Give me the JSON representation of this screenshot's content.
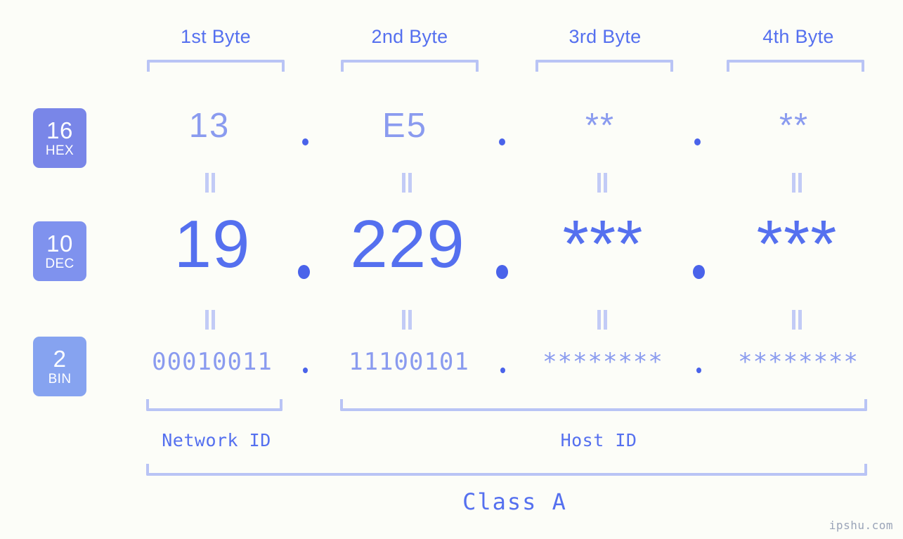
{
  "meta": {
    "watermark": "ipshu.com",
    "background_color": "#fcfdf8",
    "accent_strong": "#5570ef",
    "accent_light": "#8a9bef",
    "accent_pale": "#b9c4f5"
  },
  "columns": [
    {
      "header": "1st Byte"
    },
    {
      "header": "2nd Byte"
    },
    {
      "header": "3rd Byte"
    },
    {
      "header": "4th Byte"
    }
  ],
  "rows": [
    {
      "badge_number": "16",
      "badge_name": "HEX",
      "badge_color": "#7986e8",
      "values": [
        "13",
        "E5",
        "**",
        "**"
      ]
    },
    {
      "badge_number": "10",
      "badge_name": "DEC",
      "badge_color": "#7f92ee",
      "values": [
        "19",
        "229",
        "***",
        "***"
      ]
    },
    {
      "badge_number": "2",
      "badge_name": "BIN",
      "badge_color": "#86a3f0",
      "values": [
        "00010011",
        "11100101",
        "********",
        "********"
      ]
    }
  ],
  "separators": {
    "dot": "."
  },
  "equals_marks": {
    "symbol": "="
  },
  "id_sections": [
    {
      "label": "Network ID"
    },
    {
      "label": "Host ID"
    }
  ],
  "class_label": "Class A"
}
